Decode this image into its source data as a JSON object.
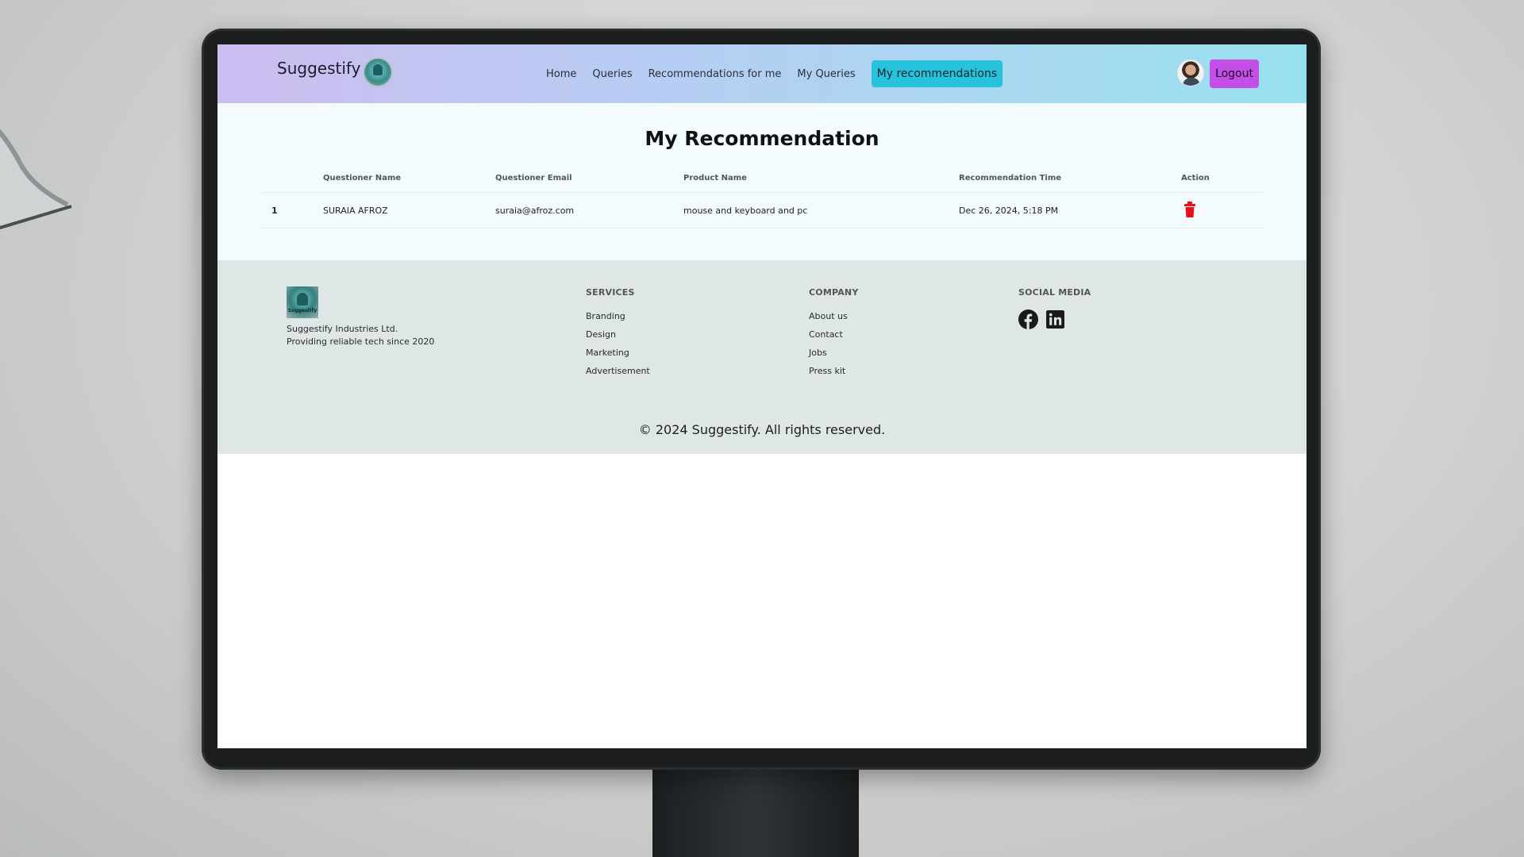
{
  "navbar": {
    "brand": "Suggestify",
    "links": [
      "Home",
      "Queries",
      "Recommendations for me",
      "My Queries"
    ],
    "active_link": "My recommendations",
    "logout_label": "Logout"
  },
  "main": {
    "title": "My Recommendation",
    "columns": [
      "",
      "Questioner Name",
      "Questioner Email",
      "Product Name",
      "Recommendation Time",
      "Action"
    ],
    "rows": [
      {
        "index": "1",
        "questioner_name": "SURAIA AFROZ",
        "questioner_email": "suraia@afroz.com",
        "product_name": "mouse and keyboard and pc",
        "time": "Dec 26, 2024, 5:18 PM",
        "action_icon": "trash-icon"
      }
    ]
  },
  "footer": {
    "logo_text": "Suggestify",
    "company_name": "Suggestify Industries Ltd.",
    "tagline": "Providing reliable tech since 2020",
    "services_heading": "SERVICES",
    "services": [
      "Branding",
      "Design",
      "Marketing",
      "Advertisement"
    ],
    "company_heading": "COMPANY",
    "company_links": [
      "About us",
      "Contact",
      "Jobs",
      "Press kit"
    ],
    "social_heading": "SOCIAL MEDIA",
    "social_icons": [
      "facebook-icon",
      "linkedin-icon"
    ],
    "copyright": "© 2024 Suggestify. All rights reserved."
  },
  "colors": {
    "nav_active_bg": "#27c3dc",
    "logout_bg": "#c44ee8",
    "delete_icon": "#e8101b",
    "footer_bg": "#dfe6e6"
  }
}
